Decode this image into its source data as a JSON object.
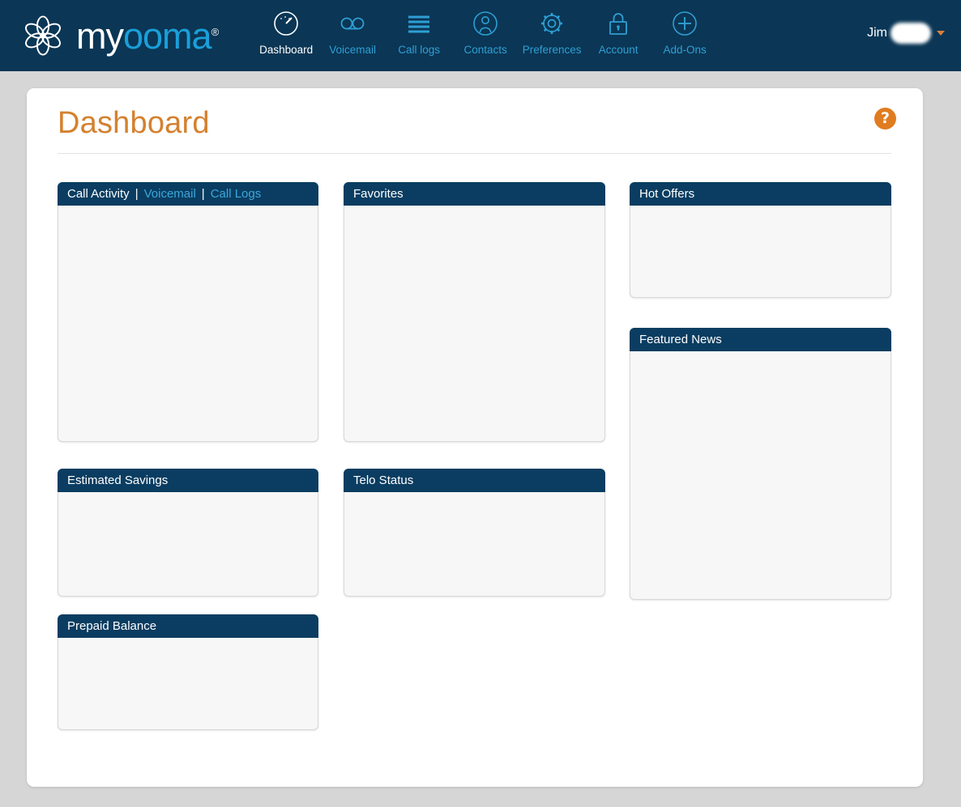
{
  "brand": {
    "word_first": "my",
    "word_second": "ooma",
    "registered_mark": "®",
    "logo_icon": "ooma-flower-logo"
  },
  "nav": {
    "items": [
      {
        "label": "Dashboard",
        "icon": "gauge-icon",
        "active": true
      },
      {
        "label": "Voicemail",
        "icon": "voicemail-icon",
        "active": false
      },
      {
        "label": "Call logs",
        "icon": "list-lines-icon",
        "active": false
      },
      {
        "label": "Contacts",
        "icon": "person-circle-icon",
        "active": false
      },
      {
        "label": "Preferences",
        "icon": "gear-icon",
        "active": false
      },
      {
        "label": "Account",
        "icon": "lock-icon",
        "active": false
      },
      {
        "label": "Add-Ons",
        "icon": "plus-circle-icon",
        "active": false
      }
    ]
  },
  "user": {
    "name": "Jim",
    "redacted_surname": "",
    "caret_icon": "chevron-down-icon"
  },
  "page": {
    "title": "Dashboard",
    "help_label": "?",
    "help_icon": "help-question-icon"
  },
  "panels": {
    "call_activity": {
      "title": "Call Activity",
      "tabs": [
        {
          "label": "Call Activity",
          "active": true
        },
        {
          "label": "Voicemail",
          "active": false
        },
        {
          "label": "Call Logs",
          "active": false
        }
      ],
      "separator": "|",
      "body": ""
    },
    "favorites": {
      "title": "Favorites",
      "body": ""
    },
    "hot_offers": {
      "title": "Hot Offers",
      "body": ""
    },
    "featured_news": {
      "title": "Featured News",
      "body": ""
    },
    "est_savings": {
      "title": "Estimated Savings",
      "body": ""
    },
    "telo_status": {
      "title": "Telo Status",
      "body": ""
    },
    "prepaid": {
      "title": "Prepaid Balance",
      "body": ""
    }
  },
  "colors": {
    "navbar": "#0b3655",
    "panel_header": "#0a3d61",
    "accent_orange": "#d4812f",
    "link_blue": "#3ba7dd",
    "page_background": "#d6d6d6",
    "panel_body": "#f7f7f7"
  }
}
